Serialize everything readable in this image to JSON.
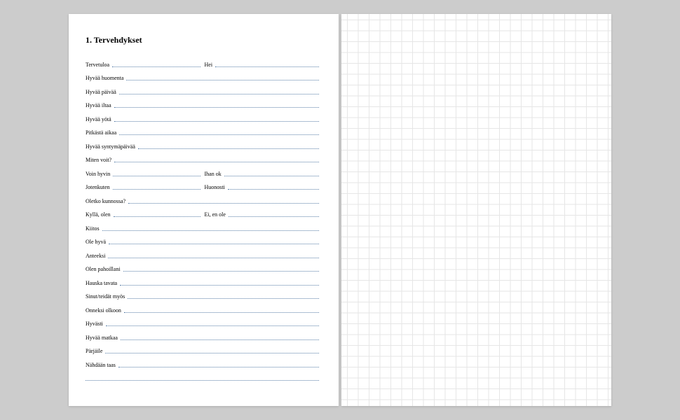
{
  "document": {
    "heading": "1. Tervehdykset",
    "rows": [
      {
        "type": "split",
        "left": "Tervetuloa",
        "right": "Hei"
      },
      {
        "type": "full",
        "left": "Hyvää huomenta"
      },
      {
        "type": "full",
        "left": "Hyvää päivää"
      },
      {
        "type": "full",
        "left": "Hyvää iltaa"
      },
      {
        "type": "full",
        "left": "Hyvää yötä"
      },
      {
        "type": "full",
        "left": "Pitkästä aikaa"
      },
      {
        "type": "full",
        "left": "Hyvää syntymäpäivää"
      },
      {
        "type": "full",
        "left": "Miten voit?"
      },
      {
        "type": "split",
        "left": "Voin hyvin",
        "right": "Ihan ok"
      },
      {
        "type": "split",
        "left": "Jotenkuten",
        "right": "Huonosti"
      },
      {
        "type": "full",
        "left": "Oletko kunnossa?"
      },
      {
        "type": "split",
        "left": "Kyllä, olen",
        "right": "Ei, en ole"
      },
      {
        "type": "full",
        "left": "Kiitos"
      },
      {
        "type": "full",
        "left": "Ole hyvä"
      },
      {
        "type": "full",
        "left": "Anteeksi"
      },
      {
        "type": "full",
        "left": "Olen pahoillani"
      },
      {
        "type": "full",
        "left": "Hauska tavata"
      },
      {
        "type": "full",
        "left": "Sinut/teidät myös"
      },
      {
        "type": "full",
        "left": "Onneksi olkoon"
      },
      {
        "type": "full",
        "left": "Hyvästi"
      },
      {
        "type": "full",
        "left": "Hyvää matkaa"
      },
      {
        "type": "full",
        "left": "Pärjäile"
      },
      {
        "type": "full",
        "left": "Nähdään taas"
      },
      {
        "type": "blank"
      }
    ]
  }
}
